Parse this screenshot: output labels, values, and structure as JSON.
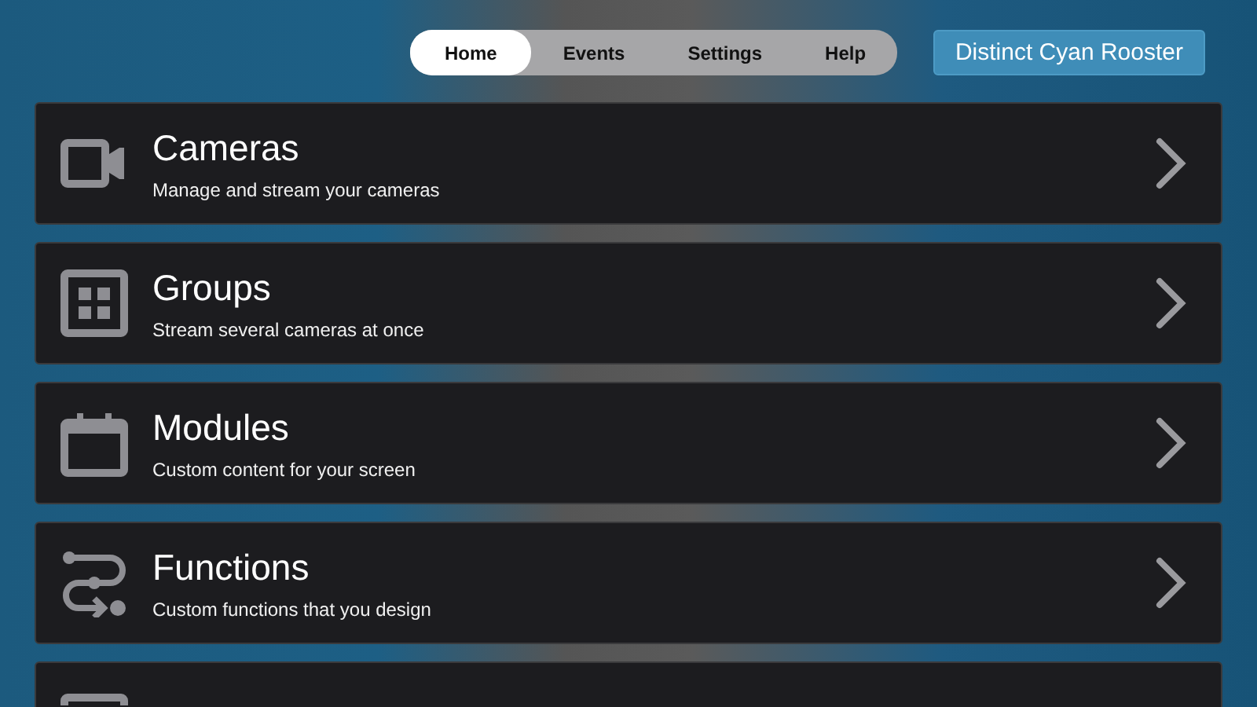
{
  "tabs": [
    {
      "label": "Home",
      "selected": true
    },
    {
      "label": "Events",
      "selected": false
    },
    {
      "label": "Settings",
      "selected": false
    },
    {
      "label": "Help",
      "selected": false
    }
  ],
  "account_button": "Distinct Cyan Rooster",
  "menu_items": [
    {
      "kind": "camera",
      "title": "Cameras",
      "subtitle": "Manage and stream your cameras"
    },
    {
      "kind": "grid",
      "title": "Groups",
      "subtitle": "Stream several cameras at once"
    },
    {
      "kind": "calendar",
      "title": "Modules",
      "subtitle": "Custom content for your screen"
    },
    {
      "kind": "flow",
      "title": "Functions",
      "subtitle": "Custom functions that you design"
    },
    {
      "kind": "screen"
    }
  ]
}
